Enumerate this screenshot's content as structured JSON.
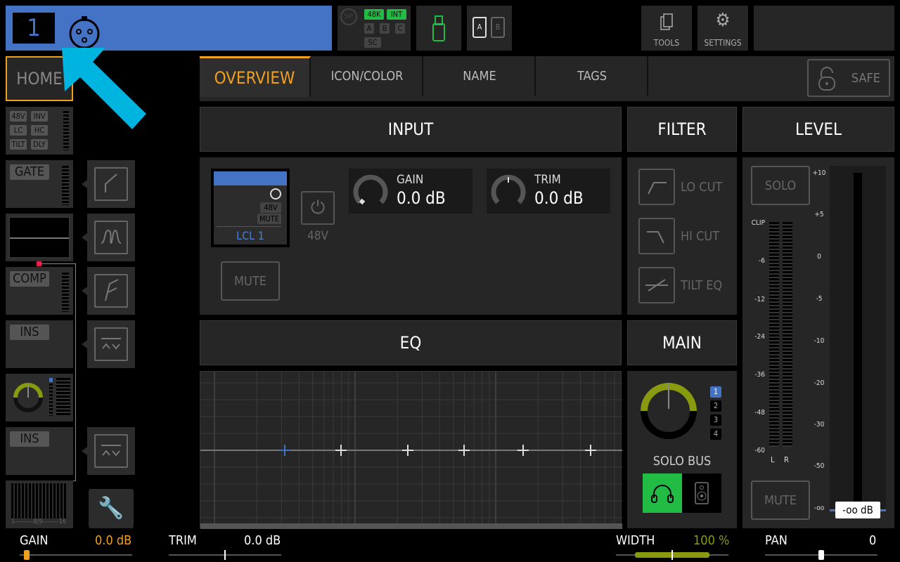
{
  "header": {
    "channel_number": "1",
    "channel_color": "#4472c4",
    "icon": "xlr-connector-icon"
  },
  "status": {
    "sip": "SIP",
    "rate": "48K",
    "clock": "INT",
    "a": "A",
    "b": "B",
    "c": "C",
    "sc": "SC",
    "card_a": "A",
    "card_b": "B"
  },
  "toolbar": {
    "tools": "TOOLS",
    "settings": "SETTINGS"
  },
  "home": "HOME",
  "tabs": [
    {
      "label": "OVERVIEW",
      "active": true
    },
    {
      "label": "ICON/COLOR"
    },
    {
      "label": "NAME"
    },
    {
      "label": "TAGS"
    }
  ],
  "safe": "SAFE",
  "left": {
    "input_tags": [
      "48V",
      "INV",
      "LC",
      "HC",
      "TILT",
      "DLY"
    ],
    "gate": "GATE",
    "comp": "COMP",
    "ins1": "INS",
    "ins2": "INS",
    "bus_range": "1---------8|9--------16"
  },
  "sections": {
    "input": "INPUT",
    "filter": "FILTER",
    "level": "LEVEL",
    "eq": "EQ",
    "main": "MAIN"
  },
  "input": {
    "source_tags": [
      "48V",
      "MUTE"
    ],
    "source": "LCL 1",
    "phantom": "48V",
    "mute": "MUTE",
    "gain": {
      "label": "GAIN",
      "value": "0.0 dB"
    },
    "trim": {
      "label": "TRIM",
      "value": "0.0 dB"
    }
  },
  "filter": {
    "lo_cut": "LO CUT",
    "hi_cut": "HI CUT",
    "tilt": "TILT EQ"
  },
  "level": {
    "solo": "SOLO",
    "mute": "MUTE",
    "meter_scale": [
      "CLIP",
      "-6",
      "-12",
      "-24",
      "-36",
      "-48",
      "-60"
    ],
    "meter_channels": [
      "L",
      "R"
    ],
    "fader_scale": [
      "+10",
      "+5",
      "0",
      "-5",
      "-10",
      "-20",
      "-30",
      "-50",
      "-oo"
    ],
    "fader_value": "-oo dB"
  },
  "main": {
    "buses": [
      "1",
      "2",
      "3",
      "4"
    ],
    "selected_bus": "1",
    "solo_bus": "SOLO BUS",
    "accent": "#8a9a10",
    "solo_active": "#22bb44"
  },
  "bottom": {
    "gain_label": "GAIN",
    "gain_value": "0.0 dB",
    "trim_label": "TRIM",
    "trim_value": "0.0 dB",
    "width_label": "WIDTH",
    "width_value": "100 %",
    "pan_label": "PAN",
    "pan_value": "0"
  },
  "colors": {
    "accent": "#f0a020",
    "highlight": "#00b4e0"
  }
}
